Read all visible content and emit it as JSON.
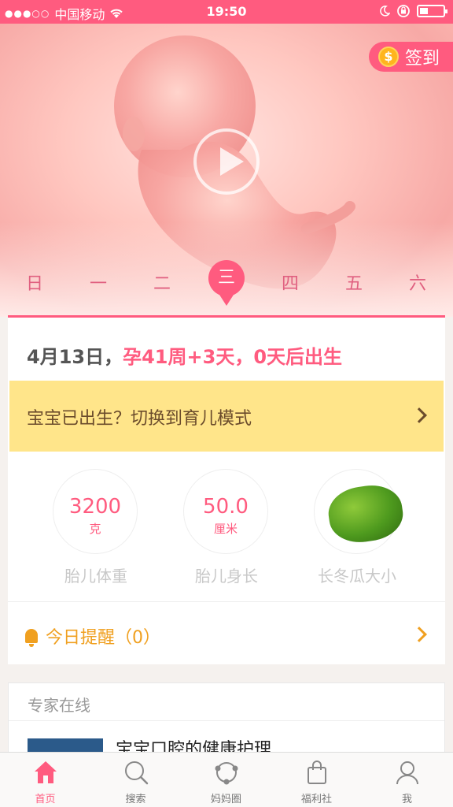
{
  "status_bar": {
    "signal": "●●●○○",
    "carrier": "中国移动",
    "time": "19:50"
  },
  "hero": {
    "checkin_label": "签到",
    "coin_symbol": "$",
    "days": [
      "日",
      "一",
      "二",
      "三",
      "四",
      "五",
      "六"
    ],
    "active_day_index": 3
  },
  "summary": {
    "date": "4月13日，",
    "pregnancy_week": "孕41周+3天，",
    "due": "0天后出生"
  },
  "born_banner": {
    "text": "宝宝已出生？切换到育儿模式"
  },
  "stats": [
    {
      "value": "3200",
      "unit": "克",
      "label": "胎儿体重"
    },
    {
      "value": "50.0",
      "unit": "厘米",
      "label": "胎儿身长"
    },
    {
      "label": "长冬瓜大小"
    }
  ],
  "reminder": {
    "label": "今日提醒（0）"
  },
  "experts": {
    "title": "专家在线",
    "article_title": "宝宝口腔的健康护理"
  },
  "tabbar": [
    {
      "label": "首页",
      "icon": "home-icon",
      "active": true
    },
    {
      "label": "搜索",
      "icon": "search-icon",
      "active": false
    },
    {
      "label": "妈妈圈",
      "icon": "community-icon",
      "active": false
    },
    {
      "label": "福利社",
      "icon": "shopping-bag-icon",
      "active": false
    },
    {
      "label": "我",
      "icon": "profile-icon",
      "active": false
    }
  ],
  "colors": {
    "accent": "#ff5b7f",
    "banner": "#ffe58a",
    "reminder": "#f0a020"
  }
}
